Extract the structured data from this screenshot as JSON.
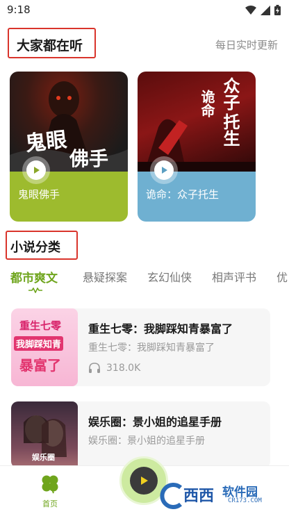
{
  "status_bar": {
    "time": "9:18"
  },
  "listen_section": {
    "title": "大家都在听",
    "subtitle": "每日实时更新",
    "books": [
      {
        "footer_label": "鬼眼佛手",
        "cover_text_1": "鬼眼",
        "cover_text_2": "佛手",
        "footer_color": "#9dbb2e"
      },
      {
        "footer_label": "诡命：众子托生",
        "cover_text_1": "众子",
        "cover_text_2": "托生",
        "cover_text_3": "诡命",
        "footer_color": "#6fb0d1"
      }
    ]
  },
  "category_section": {
    "title": "小说分类",
    "tabs": [
      "都市爽文",
      "悬疑探案",
      "玄幻仙侠",
      "相声评书",
      "优"
    ],
    "active_tab": 0
  },
  "novels": [
    {
      "title": "重生七零：我脚踩知青暴富了",
      "desc": "重生七零：我脚踩知青暴富了",
      "plays": "318.0K",
      "thumb_text_1": "重生七零",
      "thumb_text_2": "我脚踩知青",
      "thumb_text_3": "暴富了"
    },
    {
      "title": "娱乐圈：景小姐的追星手册",
      "desc": "娱乐圈：景小姐的追星手册",
      "plays": "",
      "thumb_text_1": "娱乐圈"
    }
  ],
  "bottom_nav": {
    "home_label": "首页"
  },
  "watermark": {
    "logo": "西西",
    "main": "软件园",
    "sub": "CR173.COM"
  },
  "colors": {
    "accent": "#6fa51d",
    "highlight": "#d9342b"
  }
}
